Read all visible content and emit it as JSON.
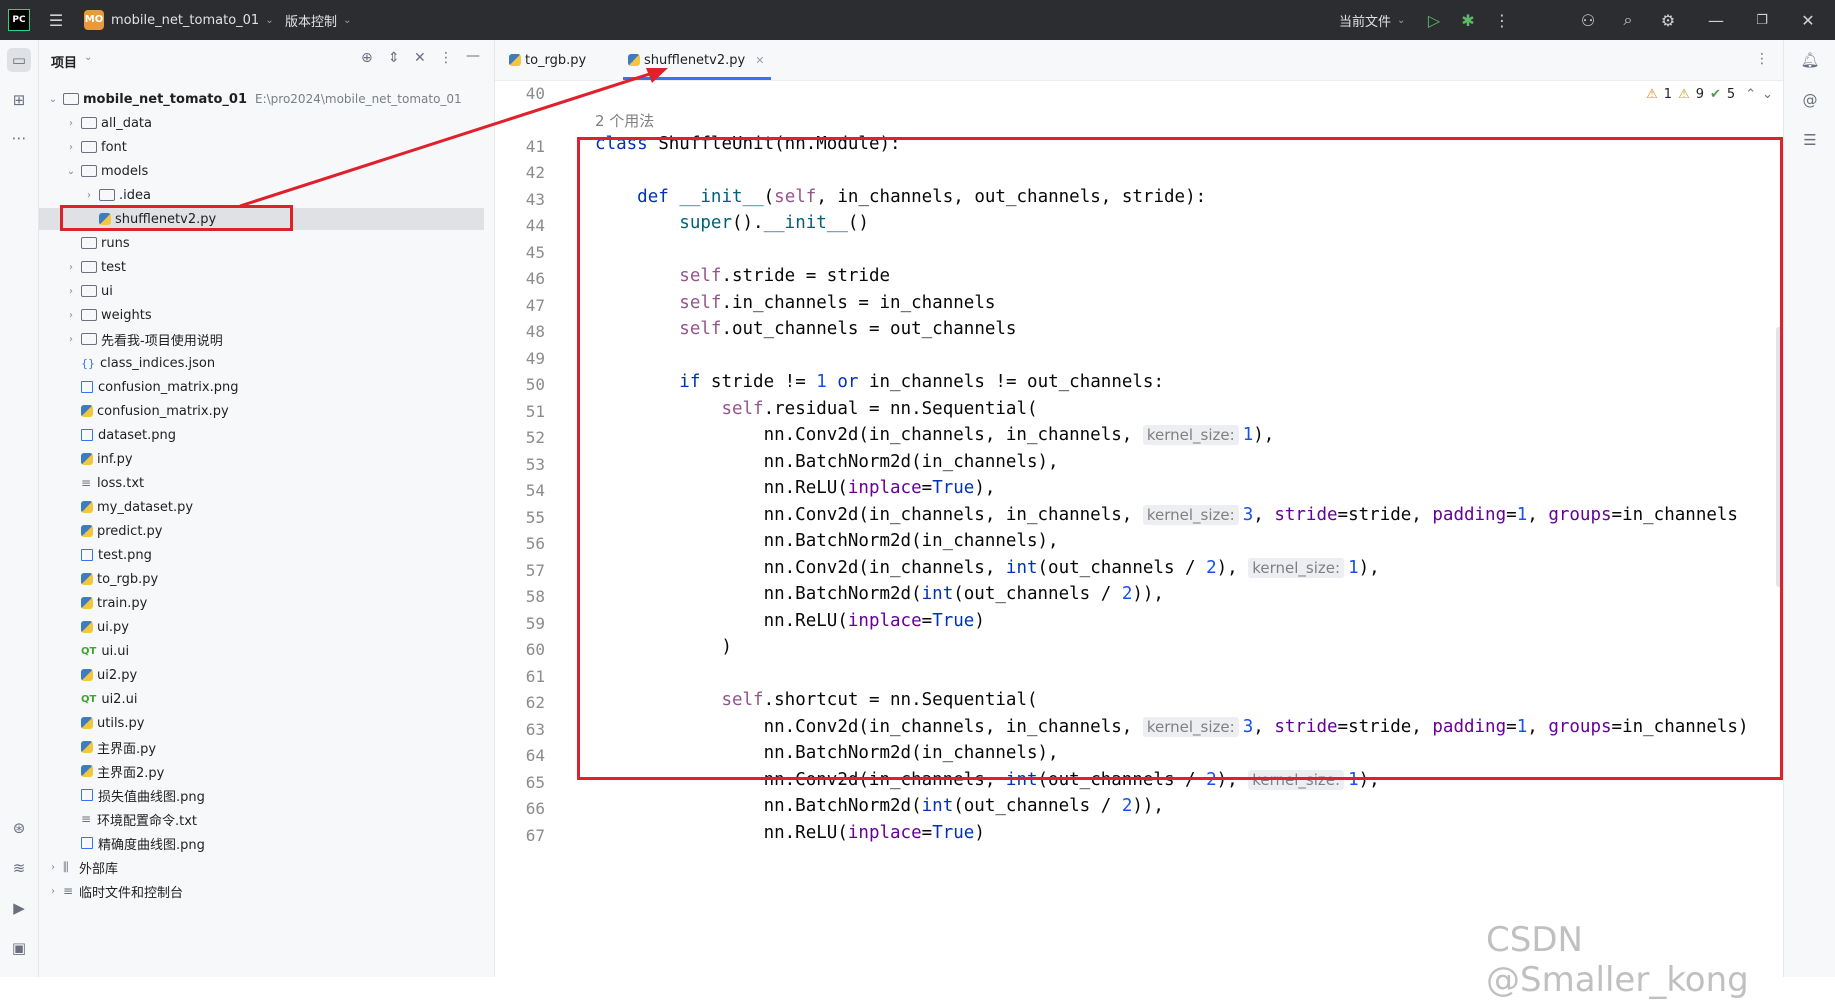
{
  "titlebar": {
    "logo": "PC",
    "project_badge": "MO",
    "project_name": "mobile_net_tomato_01",
    "vcs": "版本控制",
    "run_config": "当前文件"
  },
  "project_panel": {
    "title": "项目",
    "root_name": "mobile_net_tomato_01",
    "root_path": "E:\\pro2024\\mobile_net_tomato_01",
    "items": [
      {
        "label": "all_data",
        "type": "folder",
        "level": 1,
        "chevron": "right"
      },
      {
        "label": "font",
        "type": "folder",
        "level": 1,
        "chevron": "right"
      },
      {
        "label": "models",
        "type": "folder",
        "level": 1,
        "chevron": "down"
      },
      {
        "label": ".idea",
        "type": "folder",
        "level": 2,
        "chevron": "right"
      },
      {
        "label": "shufflenetv2.py",
        "type": "py",
        "level": 2,
        "chevron": "",
        "selected": true
      },
      {
        "label": "runs",
        "type": "folder",
        "level": 1,
        "chevron": ""
      },
      {
        "label": "test",
        "type": "folder",
        "level": 1,
        "chevron": "right"
      },
      {
        "label": "ui",
        "type": "folder",
        "level": 1,
        "chevron": "right"
      },
      {
        "label": "weights",
        "type": "folder",
        "level": 1,
        "chevron": "right"
      },
      {
        "label": "先看我-项目使用说明",
        "type": "folder",
        "level": 1,
        "chevron": "right"
      },
      {
        "label": "class_indices.json",
        "type": "json",
        "level": 1,
        "chevron": ""
      },
      {
        "label": "confusion_matrix.png",
        "type": "png",
        "level": 1,
        "chevron": ""
      },
      {
        "label": "confusion_matrix.py",
        "type": "py",
        "level": 1,
        "chevron": ""
      },
      {
        "label": "dataset.png",
        "type": "png",
        "level": 1,
        "chevron": ""
      },
      {
        "label": "inf.py",
        "type": "py",
        "level": 1,
        "chevron": ""
      },
      {
        "label": "loss.txt",
        "type": "txt",
        "level": 1,
        "chevron": ""
      },
      {
        "label": "my_dataset.py",
        "type": "py",
        "level": 1,
        "chevron": ""
      },
      {
        "label": "predict.py",
        "type": "py",
        "level": 1,
        "chevron": ""
      },
      {
        "label": "test.png",
        "type": "png",
        "level": 1,
        "chevron": ""
      },
      {
        "label": "to_rgb.py",
        "type": "py",
        "level": 1,
        "chevron": ""
      },
      {
        "label": "train.py",
        "type": "py",
        "level": 1,
        "chevron": ""
      },
      {
        "label": "ui.py",
        "type": "py",
        "level": 1,
        "chevron": ""
      },
      {
        "label": "ui.ui",
        "type": "ui",
        "level": 1,
        "chevron": ""
      },
      {
        "label": "ui2.py",
        "type": "py",
        "level": 1,
        "chevron": ""
      },
      {
        "label": "ui2.ui",
        "type": "ui",
        "level": 1,
        "chevron": ""
      },
      {
        "label": "utils.py",
        "type": "py",
        "level": 1,
        "chevron": ""
      },
      {
        "label": "主界面.py",
        "type": "py",
        "level": 1,
        "chevron": ""
      },
      {
        "label": "主界面2.py",
        "type": "py",
        "level": 1,
        "chevron": ""
      },
      {
        "label": "损失值曲线图.png",
        "type": "png",
        "level": 1,
        "chevron": ""
      },
      {
        "label": "环境配置命令.txt",
        "type": "txt",
        "level": 1,
        "chevron": ""
      },
      {
        "label": "精确度曲线图.png",
        "type": "png",
        "level": 1,
        "chevron": ""
      },
      {
        "label": "外部库",
        "type": "lib",
        "level": 0,
        "chevron": "right"
      },
      {
        "label": "临时文件和控制台",
        "type": "scratch",
        "level": 0,
        "chevron": "right"
      }
    ]
  },
  "tabs": [
    {
      "label": "to_rgb.py",
      "active": false
    },
    {
      "label": "shufflenetv2.py",
      "active": true
    }
  ],
  "inspections": {
    "warnings": "1",
    "weak_warnings": "9",
    "ok": "5"
  },
  "editor": {
    "usages_label": "2 个用法",
    "lines": [
      {
        "n": "40",
        "html": ""
      },
      {
        "n": "41",
        "html": "<span class=\"kw\">class</span> ShuffleUnit(nn.Module):"
      },
      {
        "n": "42",
        "html": ""
      },
      {
        "n": "43",
        "html": "    <span class=\"kw\">def</span> <span class=\"fn\">__init__</span>(<span class=\"slf\">self</span>, in_channels, out_channels, stride):"
      },
      {
        "n": "44",
        "html": "        <span class=\"fn\">super</span>().<span class=\"fn\">__init__</span>()"
      },
      {
        "n": "45",
        "html": ""
      },
      {
        "n": "46",
        "html": "        <span class=\"slf\">self</span>.stride = stride"
      },
      {
        "n": "47",
        "html": "        <span class=\"slf\">self</span>.in_channels = in_channels"
      },
      {
        "n": "48",
        "html": "        <span class=\"slf\">self</span>.out_channels = out_channels"
      },
      {
        "n": "49",
        "html": ""
      },
      {
        "n": "50",
        "html": "        <span class=\"kw\">if</span> stride != <span class=\"num\">1</span> <span class=\"kw\">or</span> in_channels != out_channels:"
      },
      {
        "n": "51",
        "html": "            <span class=\"slf\">self</span>.residual = nn.Sequential("
      },
      {
        "n": "52",
        "html": "                nn.Conv2d(in_channels, in_channels, <span class=\"hint\">kernel_size:</span><span class=\"num\">1</span>),"
      },
      {
        "n": "53",
        "html": "                nn.BatchNorm2d(in_channels),"
      },
      {
        "n": "54",
        "html": "                nn.ReLU(<span class=\"par\">inplace</span>=<span class=\"kw\">True</span>),"
      },
      {
        "n": "55",
        "html": "                nn.Conv2d(in_channels, in_channels, <span class=\"hint\">kernel_size:</span><span class=\"num\">3</span>, <span class=\"par\">stride</span>=stride, <span class=\"par\">padding</span>=<span class=\"num\">1</span>, <span class=\"par\">groups</span>=in_channels"
      },
      {
        "n": "56",
        "html": "                nn.BatchNorm2d(in_channels),"
      },
      {
        "n": "57",
        "html": "                nn.Conv2d(in_channels, <span class=\"kw\">int</span>(out_channels / <span class=\"num\">2</span>), <span class=\"hint\">kernel_size:</span><span class=\"num\">1</span>),"
      },
      {
        "n": "58",
        "html": "                nn.BatchNorm2d(<span class=\"kw\">int</span>(out_channels / <span class=\"num\">2</span>)),"
      },
      {
        "n": "59",
        "html": "                nn.ReLU(<span class=\"par\">inplace</span>=<span class=\"kw\">True</span>)"
      },
      {
        "n": "60",
        "html": "            )"
      },
      {
        "n": "61",
        "html": ""
      },
      {
        "n": "62",
        "html": "            <span class=\"slf\">self</span>.shortcut = nn.Sequential("
      },
      {
        "n": "63",
        "html": "                nn.Conv2d(in_channels, in_channels, <span class=\"hint\">kernel_size:</span><span class=\"num\">3</span>, <span class=\"par\">stride</span>=stride, <span class=\"par\">padding</span>=<span class=\"num\">1</span>, <span class=\"par\">groups</span>=in_channels)"
      },
      {
        "n": "64",
        "html": "                nn.BatchNorm2d(in_channels),"
      },
      {
        "n": "65",
        "html": "                nn.Conv2d(in_channels, <span class=\"kw\">int</span>(out_channels / <span class=\"num\">2</span>), <span class=\"hint\">kernel_size:</span><span class=\"num\">1</span>),"
      },
      {
        "n": "66",
        "html": "                nn.BatchNorm2d(<span class=\"kw\">int</span>(out_channels / <span class=\"num\">2</span>)),"
      },
      {
        "n": "67",
        "html": "                nn.ReLU(<span class=\"par\">inplace</span>=<span class=\"kw\">True</span>)"
      }
    ]
  },
  "watermark": "CSDN @Smaller_kong",
  "colors": {
    "annotation_red": "#e0202b",
    "accent": "#3574f0"
  }
}
